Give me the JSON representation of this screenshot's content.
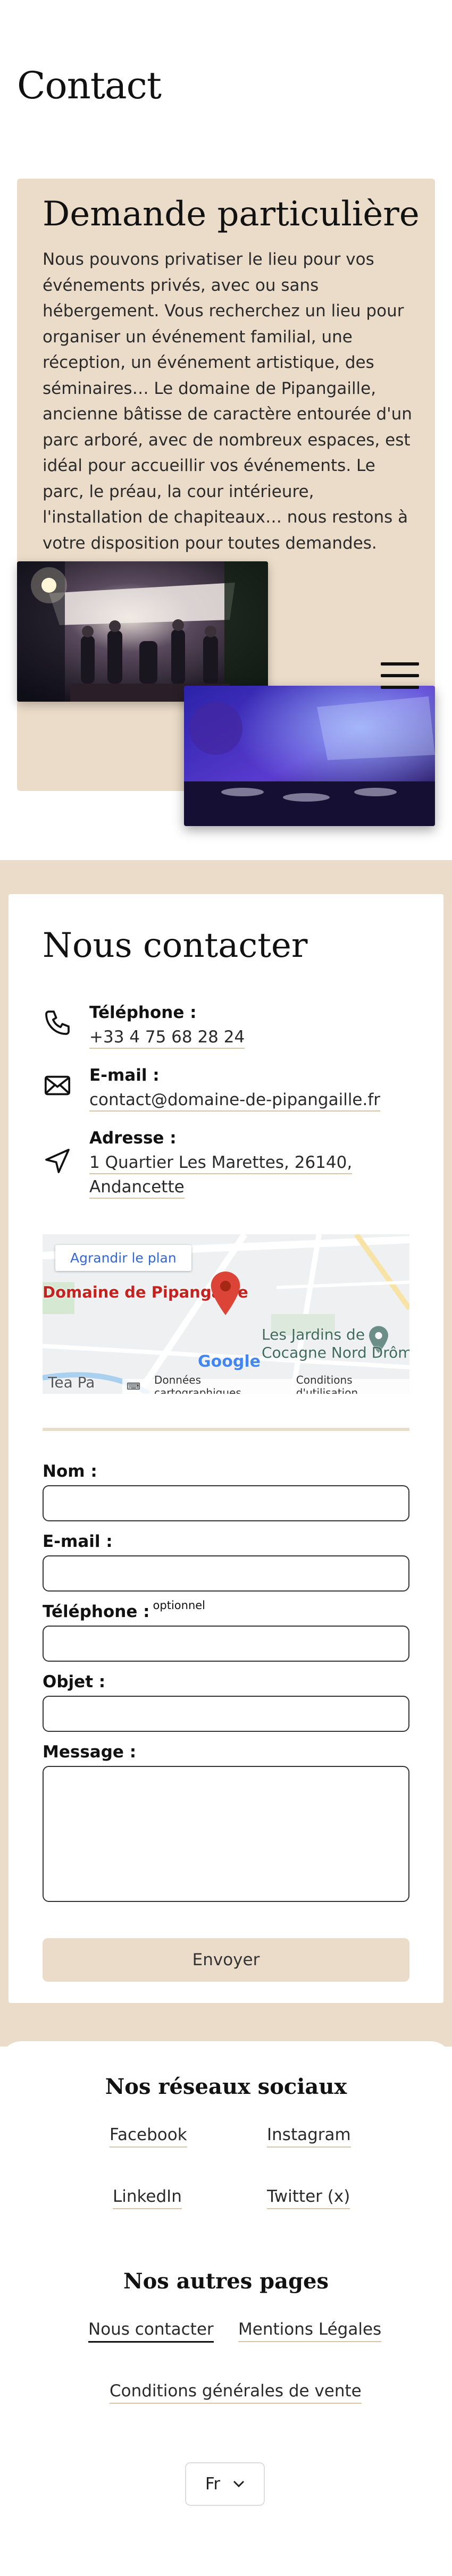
{
  "page": {
    "title": "Contact"
  },
  "demande": {
    "title": "Demande particulière",
    "text": "Nous pouvons privatiser le lieu pour vos événements privés, avec ou sans hébergement. Vous recherchez un lieu pour organiser un événement familial, une réception, un événement artistique, des séminaires… Le domaine de Pipangaille, ancienne bâtisse de caractère entourée d'un parc arboré, avec de nombreux espaces, est idéal pour accueillir vos événements. Le parc, le préau, la cour intérieure, l'installation de chapiteaux… nous restons à votre disposition pour toutes demandes."
  },
  "contact": {
    "title": "Nous contacter",
    "phone_label": "Téléphone :",
    "phone_value": "+33 4 75 68 28 24",
    "email_label": "E-mail :",
    "email_value": "contact@domaine-de-pipangaille.fr",
    "address_label": "Adresse :",
    "address_line1": "1 Quartier Les Marettes, 26140,",
    "address_line2": "Andancette"
  },
  "map": {
    "enlarge_label": "Agrandir le plan",
    "place_label": "Domaine de Pipangaille",
    "poi_line1": "Les Jardins de",
    "poi_line2": "Cocagne Nord Drôme",
    "poi_small": "Tea Pa",
    "logo": "Google",
    "footer_data": "Données cartographiques",
    "footer_terms": "Conditions d'utilisation"
  },
  "form": {
    "name_label": "Nom :",
    "email_label": "E-mail :",
    "phone_label": "Téléphone :",
    "phone_optional": "optionnel",
    "subject_label": "Objet :",
    "message_label": "Message :",
    "submit_label": "Envoyer"
  },
  "footer": {
    "social_heading": "Nos réseaux sociaux",
    "social_links": [
      "Facebook",
      "Instagram",
      "LinkedIn",
      "Twitter (x)"
    ],
    "pages_heading": "Nos autres pages",
    "page_links": [
      "Nous contacter",
      "Mentions Légales",
      "Conditions générales de vente"
    ],
    "language": "Fr"
  },
  "colors": {
    "beige": "#ebdcc9",
    "accent_underline": "#d9c5a5",
    "map_pin": "#db4437"
  }
}
